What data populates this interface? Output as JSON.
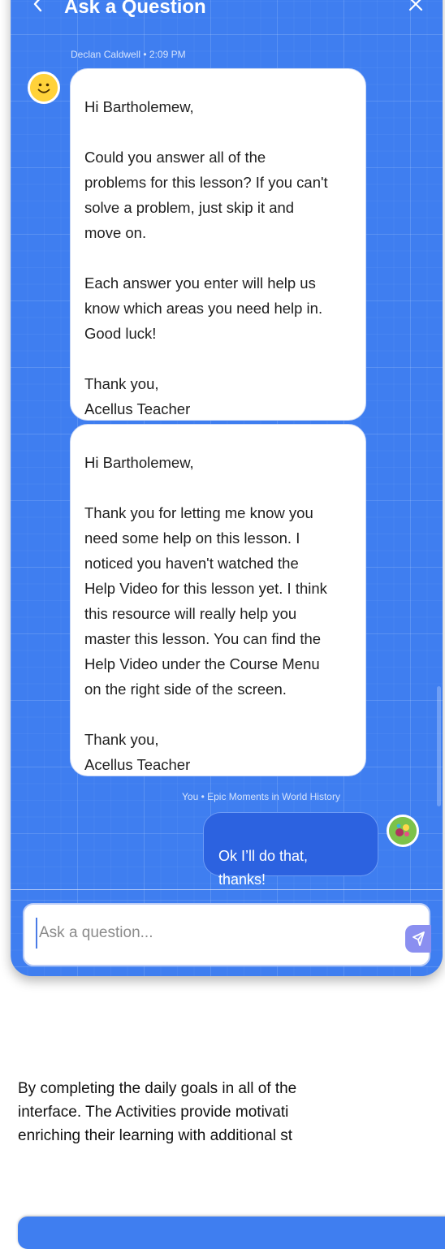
{
  "header": {
    "back_label": "<",
    "title": "Ask a Question",
    "close_label": "×"
  },
  "messages": [
    {
      "meta": "Declan Caldwell • 2:09 PM",
      "text": "Hi Bartholemew,\n\nCould you answer all of the\nproblems for this lesson? If you can't\nsolve a problem, just skip it and\nmove on.\n\nEach answer you enter will help us\nknow which areas you need help in.\nGood luck!\n\nThank you,\nAcellus Teacher"
    },
    {
      "text": "Hi Bartholemew,\n\nThank you for letting me know you\nneed some help on this lesson. I\nnoticed you haven't watched the\nHelp Video for this lesson yet. I think\nthis resource will really help you\nmaster this lesson. You can find the\nHelp Video under the Course Menu\non the right side of the screen.\n\nThank you,\nAcellus Teacher"
    }
  ],
  "reply": {
    "meta": "You • Epic Moments in World History",
    "text": "Ok I’ll do that,\nthanks!"
  },
  "input": {
    "placeholder": "Ask a question..."
  },
  "body_text": {
    "line1": "By completing the daily goals in all of the",
    "line2": "interface. The Activities provide motivati",
    "line3": "enriching their learning with additional st"
  },
  "colors": {
    "panel": "#3f7ef0",
    "you_bubble": "#2c62e0",
    "send_button": "#8a8ff0"
  },
  "icons": [
    "back-chevron-icon",
    "close-icon",
    "smiley-icon",
    "planet-avatar-icon",
    "send-icon"
  ]
}
